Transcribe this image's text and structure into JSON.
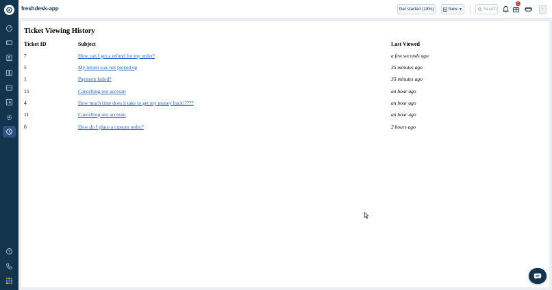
{
  "app": {
    "name": "freshdesk-app"
  },
  "toolbar": {
    "get_started_label": "Get started (18%)",
    "new_label": "New",
    "search_placeholder": "Search",
    "notification_count": "1"
  },
  "page": {
    "title": "Ticket Viewing History",
    "columns": [
      "Ticket ID",
      "Subject",
      "Last Viewed"
    ],
    "rows": [
      {
        "id": "7",
        "subject": "How can I get a refund for my order?",
        "viewed": "a few seconds ago"
      },
      {
        "id": "5",
        "subject": "My return was not picked up",
        "viewed": "35 minutes ago"
      },
      {
        "id": "1",
        "subject": "Payment failed?",
        "viewed": "35 minutes ago"
      },
      {
        "id": "15",
        "subject": "Cancelling our account",
        "viewed": "an hour ago"
      },
      {
        "id": "4",
        "subject": "How much time does it take to get my money back!????",
        "viewed": "an hour ago"
      },
      {
        "id": "11",
        "subject": "Cancelling our account",
        "viewed": "an hour ago"
      },
      {
        "id": "6",
        "subject": "How do I place a custom order?",
        "viewed": "2 hours ago"
      }
    ]
  },
  "sidebar": {
    "items": [
      "dashboard-icon",
      "tickets-icon",
      "contacts-icon",
      "knowledge-base-icon",
      "inbox-icon",
      "reports-icon",
      "admin-icon",
      "history-icon"
    ],
    "bottom_items": [
      "help-icon",
      "phone-icon",
      "apps-grid-icon"
    ]
  },
  "colors": {
    "sidebar": "#12344d",
    "link": "#1a66c7",
    "badge": "#d72d30"
  }
}
